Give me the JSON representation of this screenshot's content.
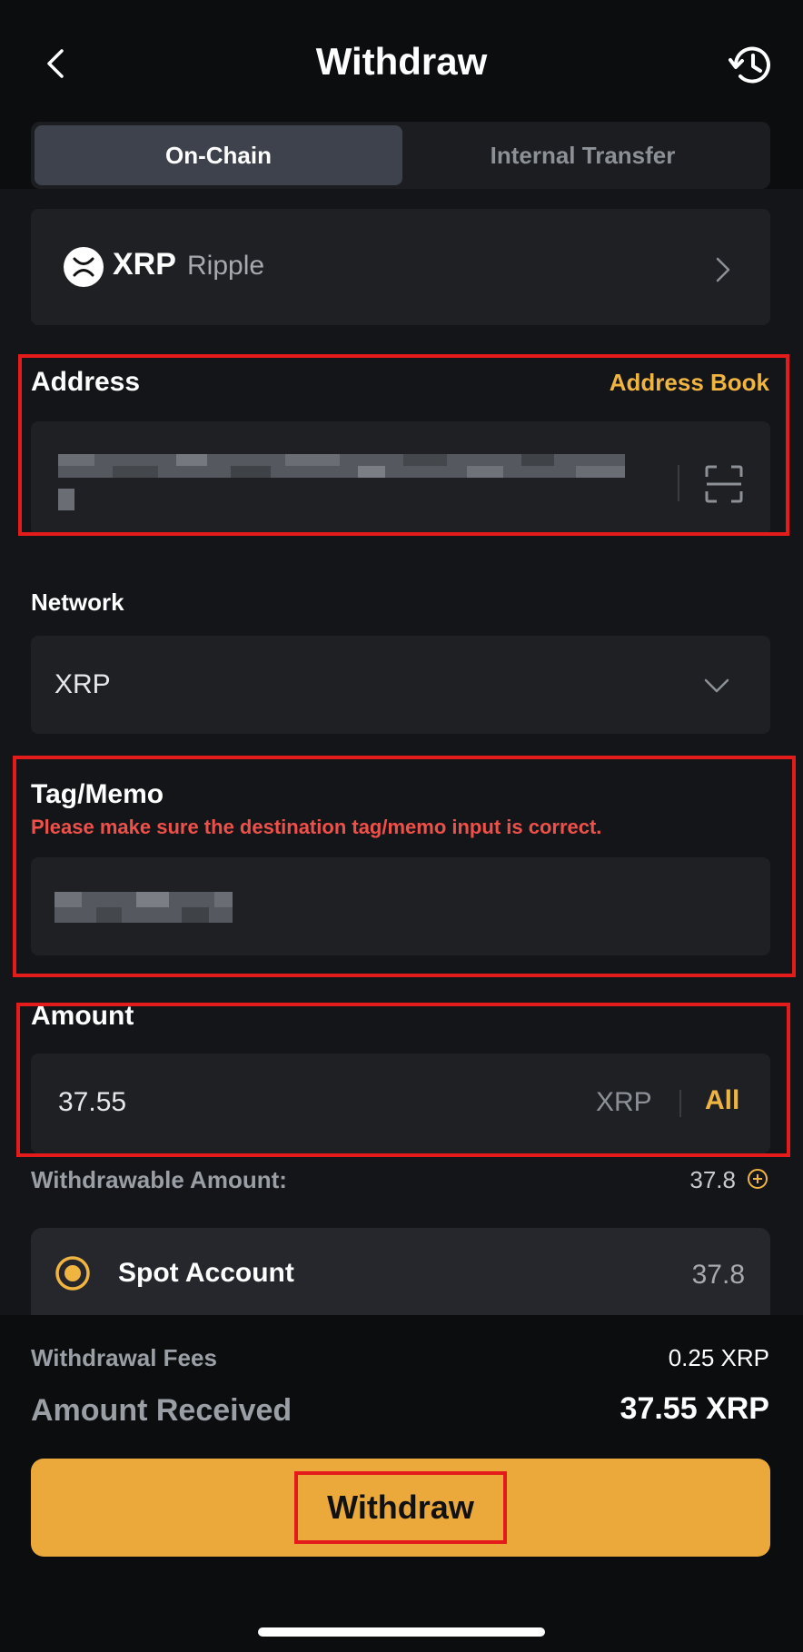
{
  "header": {
    "title": "Withdraw",
    "back_icon": "chevron-left-icon",
    "history_icon": "history-icon"
  },
  "tabs": [
    {
      "label": "On-Chain",
      "active": true
    },
    {
      "label": "Internal Transfer",
      "active": false
    }
  ],
  "coin": {
    "symbol": "XRP",
    "name": "Ripple",
    "icon": "xrp-logo-icon"
  },
  "address": {
    "label": "Address",
    "address_book_label": "Address Book",
    "value_blurred": true,
    "scan_icon": "scan-icon"
  },
  "network": {
    "label": "Network",
    "value": "XRP"
  },
  "tag": {
    "label": "Tag/Memo",
    "warning": "Please make sure the destination tag/memo input is correct.",
    "value_blurred": true
  },
  "amount": {
    "label": "Amount",
    "value": "37.55",
    "unit": "XRP",
    "all_label": "All"
  },
  "withdrawable": {
    "label": "Withdrawable Amount:",
    "value": "37.8"
  },
  "spot_account": {
    "label": "Spot Account",
    "value": "37.8",
    "selected": true
  },
  "summary": {
    "fees_label": "Withdrawal Fees",
    "fees_value": "0.25 XRP",
    "received_label": "Amount Received",
    "received_value": "37.55 XRP"
  },
  "withdraw_button": {
    "label": "Withdraw"
  },
  "colors": {
    "accent": "#eba93b",
    "link": "#f0b440",
    "warning": "#f0504a",
    "highlight_box": "#e31b1b",
    "background": "#0c0d0f",
    "card": "#1f2024"
  }
}
